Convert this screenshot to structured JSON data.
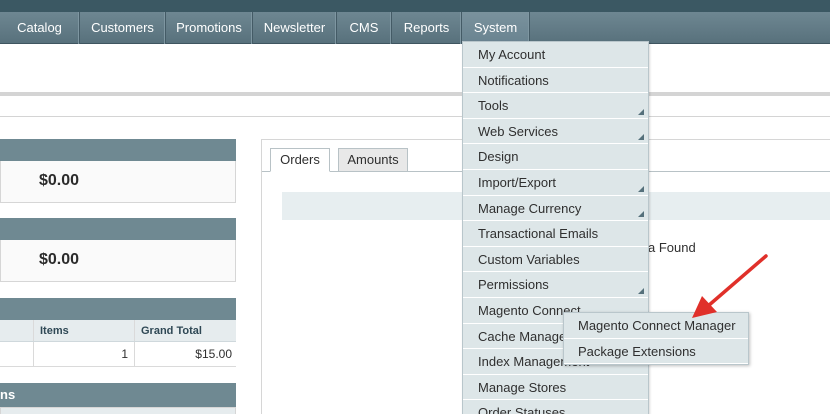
{
  "nav": {
    "items": [
      "Catalog",
      "Customers",
      "Promotions",
      "Newsletter",
      "CMS",
      "Reports",
      "System"
    ],
    "active": "System"
  },
  "dashboard": {
    "lifetime_sales_amount": "$0.00",
    "average_orders_amount": "$0.00",
    "last_orders": {
      "columns": [
        "Items",
        "Grand Total"
      ],
      "rows": [
        {
          "items": "1",
          "grand_total": "$15.00"
        }
      ]
    },
    "partial_heading": "ns"
  },
  "chart_panel": {
    "tabs": [
      "Orders",
      "Amounts"
    ],
    "active_tab": "Orders",
    "no_data_text": "a Found"
  },
  "system_menu": {
    "items": [
      {
        "label": "My Account",
        "has_submenu": false
      },
      {
        "label": "Notifications",
        "has_submenu": false
      },
      {
        "label": "Tools",
        "has_submenu": true
      },
      {
        "label": "Web Services",
        "has_submenu": true
      },
      {
        "label": "Design",
        "has_submenu": false
      },
      {
        "label": "Import/Export",
        "has_submenu": true
      },
      {
        "label": "Manage Currency",
        "has_submenu": true
      },
      {
        "label": "Transactional Emails",
        "has_submenu": false
      },
      {
        "label": "Custom Variables",
        "has_submenu": false
      },
      {
        "label": "Permissions",
        "has_submenu": true
      },
      {
        "label": "Magento Connect",
        "has_submenu": true
      },
      {
        "label": "Cache Management",
        "has_submenu": false
      },
      {
        "label": "Index Management",
        "has_submenu": false
      },
      {
        "label": "Manage Stores",
        "has_submenu": false
      },
      {
        "label": "Order Statuses",
        "has_submenu": false
      }
    ]
  },
  "connect_submenu": {
    "items": [
      "Magento Connect Manager",
      "Package Extensions"
    ]
  },
  "colors": {
    "nav_bg": "#627b86",
    "menu_bg": "#dde6e8",
    "box_header": "#6f8992",
    "annotation_arrow": "#e0302a"
  }
}
